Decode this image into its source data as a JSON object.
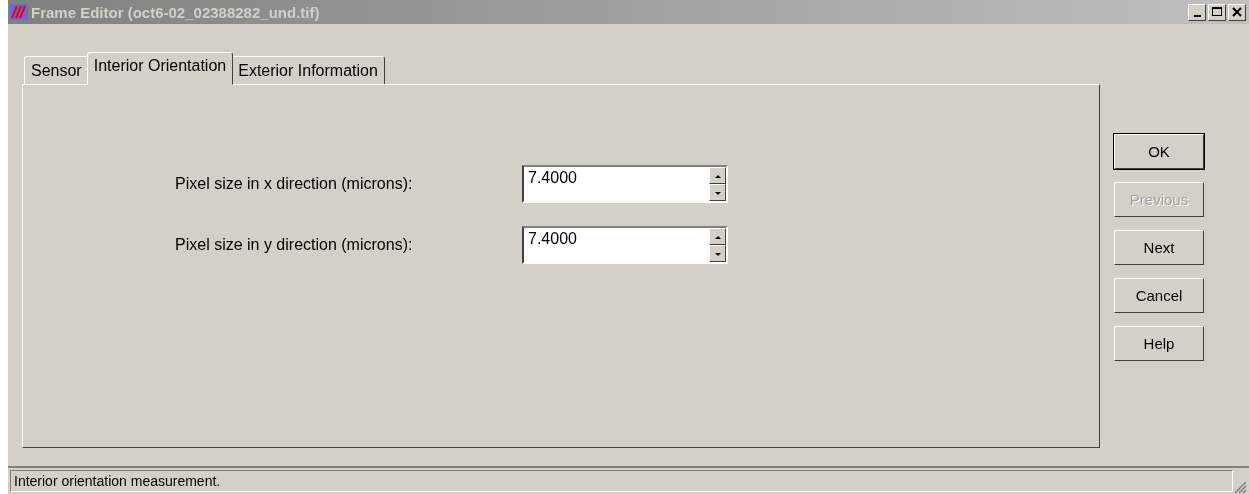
{
  "window": {
    "title": "Frame Editor (oct6-02_02388282_und.tif)",
    "active": false
  },
  "tabs": [
    {
      "label": "Sensor",
      "selected": false
    },
    {
      "label": "Interior Orientation",
      "selected": true
    },
    {
      "label": "Exterior Information",
      "selected": false
    }
  ],
  "fields": [
    {
      "label": "Pixel size in x direction (microns):",
      "value": "7.4000"
    },
    {
      "label": "Pixel size in y direction (microns):",
      "value": "7.4000"
    }
  ],
  "buttons": [
    {
      "label": "OK",
      "disabled": false,
      "default": true
    },
    {
      "label": "Previous",
      "disabled": true,
      "default": false
    },
    {
      "label": "Next",
      "disabled": false,
      "default": false
    },
    {
      "label": "Cancel",
      "disabled": false,
      "default": false
    },
    {
      "label": "Help",
      "disabled": false,
      "default": false
    }
  ],
  "status_bar": {
    "text": "Interior orientation measurement."
  }
}
